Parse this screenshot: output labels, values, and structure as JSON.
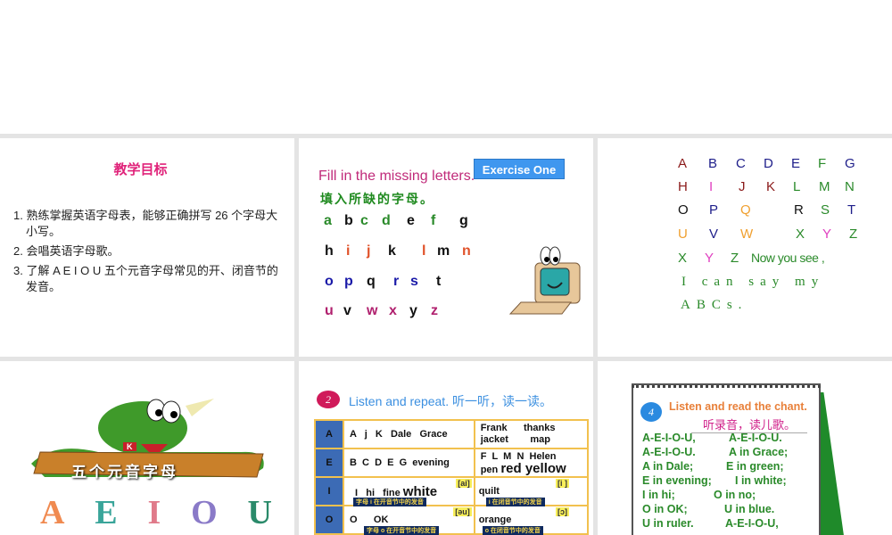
{
  "slide1": {
    "title": "教学目标",
    "goals": [
      "1. 熟练掌握英语字母表，能够正确拼写 26 个字母大小写。",
      "2. 会唱英语字母歌。",
      "3. 了解 A E I O U 五个元音字母常见的开、闭音节的发音。"
    ]
  },
  "slide2": {
    "title": "Fill in the missing letters.",
    "subtitle": "填入所缺的字母。",
    "button": "Exercise One",
    "rows": [
      [
        "a",
        "b",
        "c",
        "d",
        "e",
        "f",
        "g"
      ],
      [
        "h",
        "i",
        "j",
        "k",
        "l",
        "m",
        "n"
      ],
      [
        "o",
        "p",
        "q",
        "r",
        "s",
        "t"
      ],
      [
        "u",
        "v",
        "w",
        "x",
        "y",
        "z"
      ]
    ]
  },
  "slide3": {
    "rows": [
      [
        "A",
        "B",
        "C",
        "D",
        "E",
        "F",
        "G"
      ],
      [
        "H",
        "I",
        "J",
        "K",
        "L",
        "M",
        "N"
      ],
      [
        "O",
        "P",
        "Q",
        "R",
        "S",
        "T"
      ],
      [
        "U",
        "V",
        "W",
        "X",
        "Y",
        "Z"
      ]
    ],
    "line5": [
      "X",
      "Y",
      "Z",
      "Now you see ,"
    ],
    "line6": "I can say my",
    "line7": "ABCs."
  },
  "slide4": {
    "banner": "五个元音字母",
    "vowels": [
      "A",
      "E",
      "I",
      "O",
      "U"
    ],
    "badge": "K"
  },
  "slide5": {
    "num": "2",
    "title": "Listen and repeat. 听一听，读一读。",
    "rows": [
      {
        "letter": "A",
        "open": "A   j   K   Dale   Grace",
        "closed1": "Frank      thanks",
        "closed2": "jacket        map"
      },
      {
        "letter": "E",
        "open": "B  C  D  E  G  evening",
        "closed1": "F  L  M  N  Helen",
        "closed2a": "pen",
        "closed2b": "red yellow"
      },
      {
        "letter": "I",
        "open": "I   hi   fine",
        "openBig": "white",
        "ipaOpen": "[ai]",
        "noteOpen": "字母 i 在开音节中的发音",
        "closed": "quilt",
        "ipaClosed": "[i ]",
        "noteClosed": "i 在闭音节中的发音"
      },
      {
        "letter": "O",
        "open": "O      OK",
        "ipaOpen": "[əu]",
        "noteOpen": "字母 o 在开音节中的发音",
        "closed": "orange",
        "ipaClosed": "[ɔ]",
        "noteClosed": "o 在闭音节中的发音"
      }
    ]
  },
  "slide6": {
    "num": "4",
    "title": "Listen and read the chant.",
    "subtitle": "听录音，读儿歌。",
    "lines": [
      [
        "A-E-I-O-U,",
        "A-E-I-O-U."
      ],
      [
        "A-E-I-O-U.",
        "A in Grace;"
      ],
      [
        "A in Dale;",
        "E in green;"
      ],
      [
        "E in evening;",
        "I in white;"
      ],
      [
        "I in hi;",
        "O in no;"
      ],
      [
        "O in OK;",
        "U in blue."
      ],
      [
        "U in ruler.",
        "A-E-I-O-U,"
      ]
    ]
  }
}
